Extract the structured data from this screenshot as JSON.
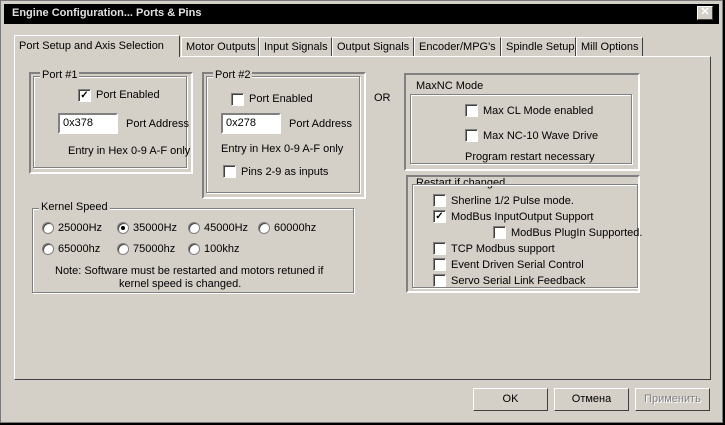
{
  "window": {
    "title": "Engine Configuration... Ports & Pins",
    "close_glyph": "✕"
  },
  "tabs": [
    "Port Setup and Axis Selection",
    "Motor Outputs",
    "Input Signals",
    "Output Signals",
    "Encoder/MPG's",
    "Spindle Setup",
    "Mill Options"
  ],
  "port1": {
    "title": "Port #1",
    "enabled_label": "Port Enabled",
    "enabled": true,
    "address_value": "0x378",
    "address_label": "Port Address",
    "hint": "Entry in Hex 0-9 A-F only"
  },
  "port2": {
    "title": "Port #2",
    "enabled_label": "Port Enabled",
    "enabled": false,
    "address_value": "0x278",
    "address_label": "Port Address",
    "hint": "Entry in Hex 0-9 A-F only",
    "pins_label": "Pins 2-9 as inputs",
    "pins_checked": false
  },
  "or_label": "OR",
  "maxnc": {
    "title": "MaxNC Mode",
    "cl_label": "Max CL Mode enabled",
    "cl_checked": false,
    "nc10_label": "Max NC-10 Wave Drive",
    "nc10_checked": false,
    "note": "Program restart necessary"
  },
  "kernel": {
    "title": "Kernel Speed",
    "options": [
      "25000Hz",
      "35000Hz",
      "45000Hz",
      "60000hz",
      "65000hz",
      "75000hz",
      "100khz"
    ],
    "selected": "35000Hz",
    "note_line1": "Note: Software must be restarted and motors retuned if",
    "note_line2": "kernel speed is changed."
  },
  "restart": {
    "title": "Restart if changed",
    "items": [
      {
        "label": "Sherline 1/2 Pulse mode.",
        "checked": false
      },
      {
        "label": "ModBus InputOutput Support",
        "checked": true
      },
      {
        "label": "ModBus PlugIn Supported.",
        "checked": false
      },
      {
        "label": "TCP Modbus support",
        "checked": false
      },
      {
        "label": "Event Driven Serial Control",
        "checked": false
      },
      {
        "label": "Servo Serial Link Feedback",
        "checked": false
      }
    ]
  },
  "buttons": {
    "ok": "OK",
    "cancel": "Отмена",
    "apply": "Применить"
  },
  "check_glyph": "✓"
}
